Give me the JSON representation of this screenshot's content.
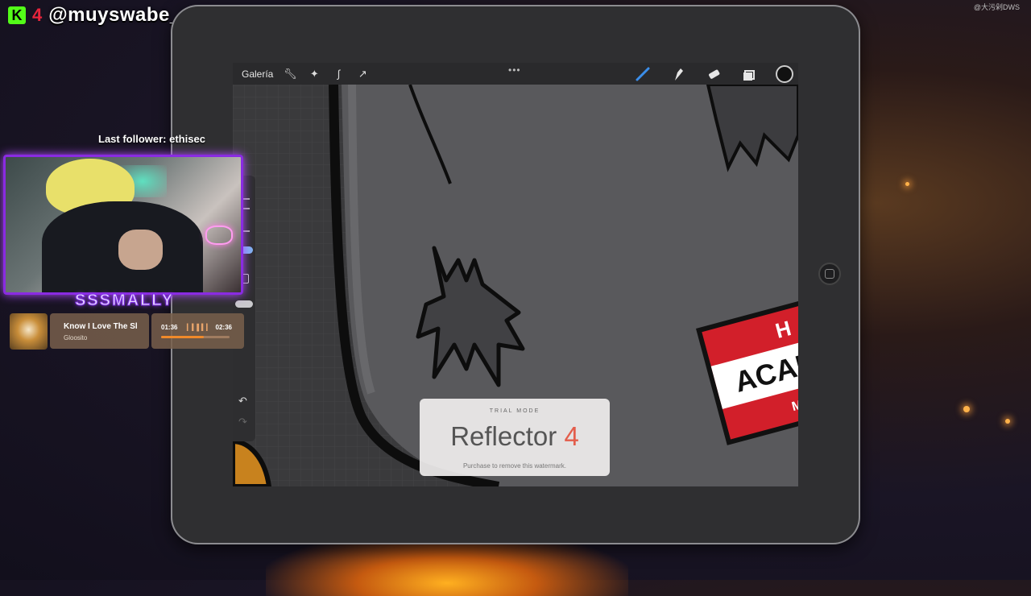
{
  "brand": {
    "kick_badge": "K",
    "count": "4",
    "handle": "@muyswabe_store"
  },
  "corner_watermark": "@大污剁DWS",
  "procreate": {
    "gallery_label": "Galería",
    "menu_dots": "•••",
    "left_tools": [
      "wrench-icon",
      "magic-wand-icon",
      "selection-icon",
      "transform-arrow-icon"
    ],
    "right_tools": [
      "brush-icon",
      "smudge-icon",
      "eraser-icon",
      "layers-icon",
      "color-icon"
    ],
    "active_color": "#111111"
  },
  "reflector": {
    "mode": "TRIAL MODE",
    "name": "Reflector",
    "version": "4",
    "message": "Purchase to remove this watermark."
  },
  "stream": {
    "last_follower_label": "Last follower: ethisec",
    "streamer_name": "SSSMALLY",
    "accent_color": "#8a2be2"
  },
  "music": {
    "title": "Know I Love The Sl",
    "artist": "Gloosito",
    "elapsed": "01:36",
    "total": "02:36",
    "progress": 0.62
  }
}
